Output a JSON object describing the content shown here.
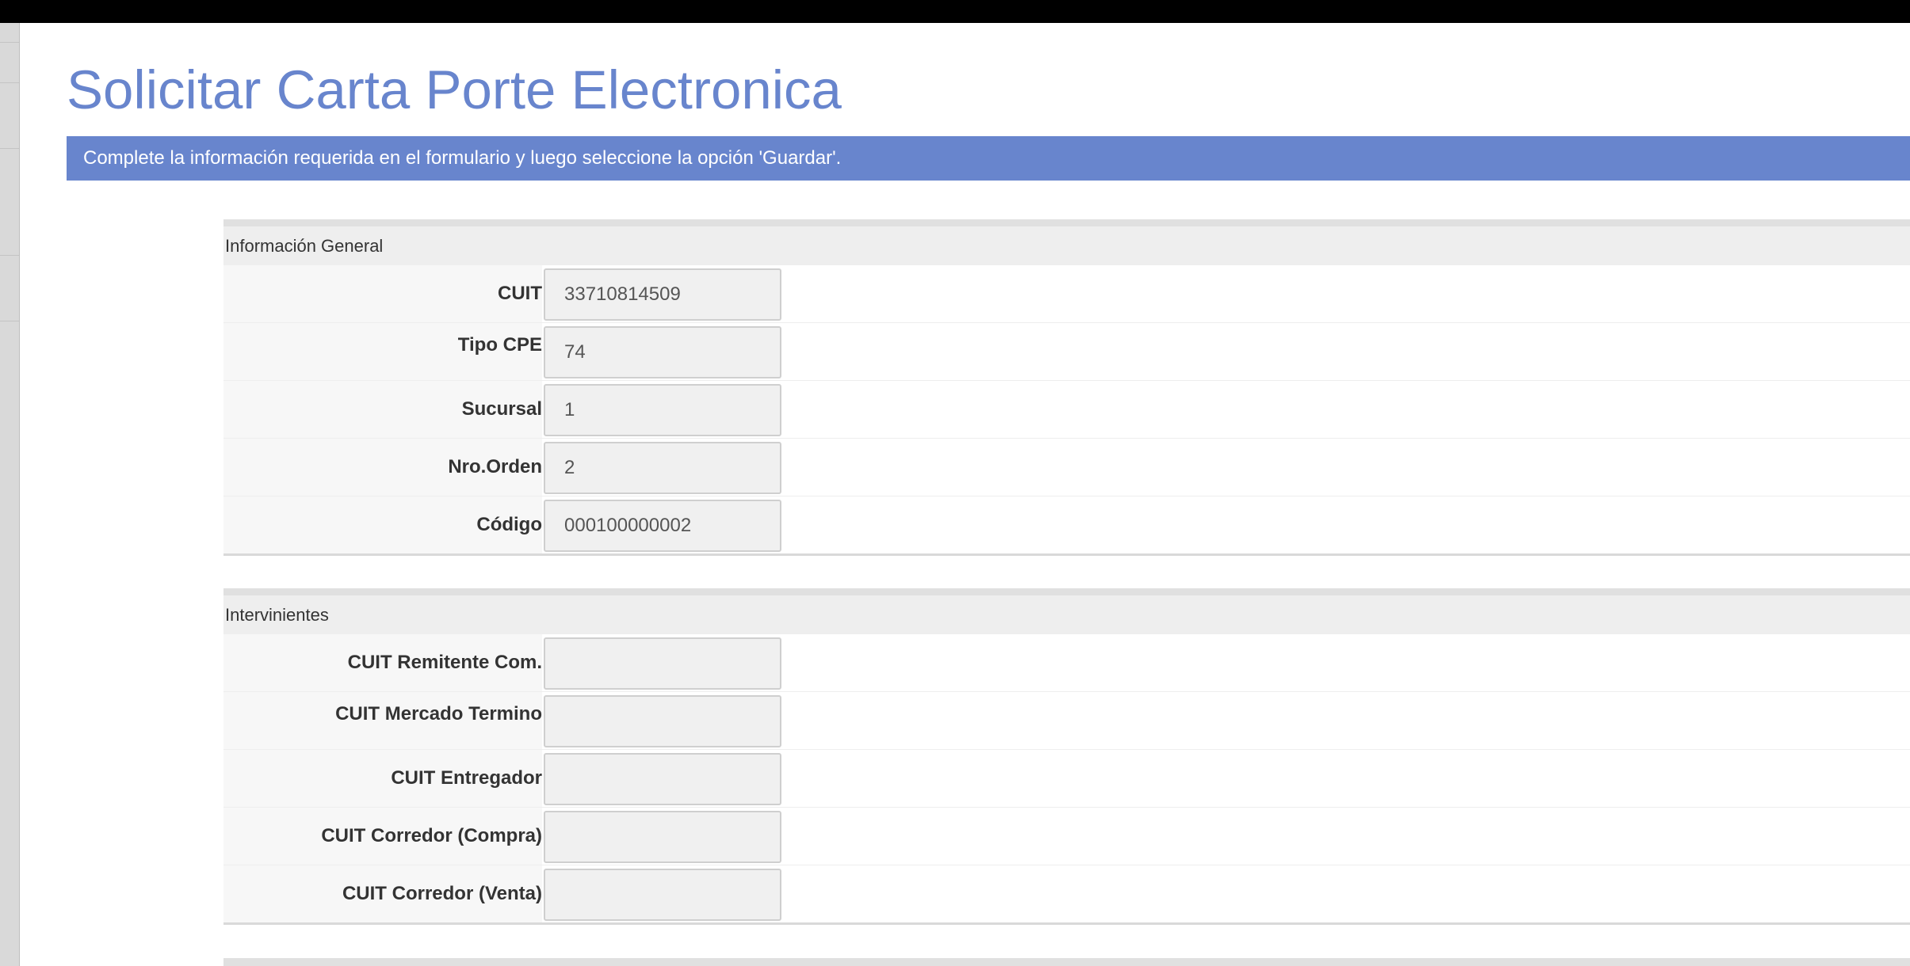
{
  "page": {
    "title": "Solicitar Carta Porte Electronica",
    "banner": "Complete la información requerida en el formulario y luego seleccione la opción 'Guardar'."
  },
  "sections": [
    {
      "title": "Información General",
      "fields": [
        {
          "label": "CUIT",
          "value": "33710814509"
        },
        {
          "label": "Tipo CPE",
          "value": "74"
        },
        {
          "label": "Sucursal",
          "value": "1"
        },
        {
          "label": "Nro.Orden",
          "value": "2"
        },
        {
          "label": "Código",
          "value": "000100000002"
        }
      ]
    },
    {
      "title": "Intervinientes",
      "fields": [
        {
          "label": "CUIT Remitente Com.",
          "value": ""
        },
        {
          "label": "CUIT Mercado Termino",
          "value": ""
        },
        {
          "label": "CUIT Entregador",
          "value": ""
        },
        {
          "label": "CUIT Corredor (Compra)",
          "value": ""
        },
        {
          "label": "CUIT Corredor (Venta)",
          "value": ""
        }
      ]
    }
  ],
  "colors": {
    "accent": "#6885cd",
    "topbar": "#000000",
    "section_header_bg": "#eeeeee",
    "field_bg": "#f0f0f0"
  }
}
